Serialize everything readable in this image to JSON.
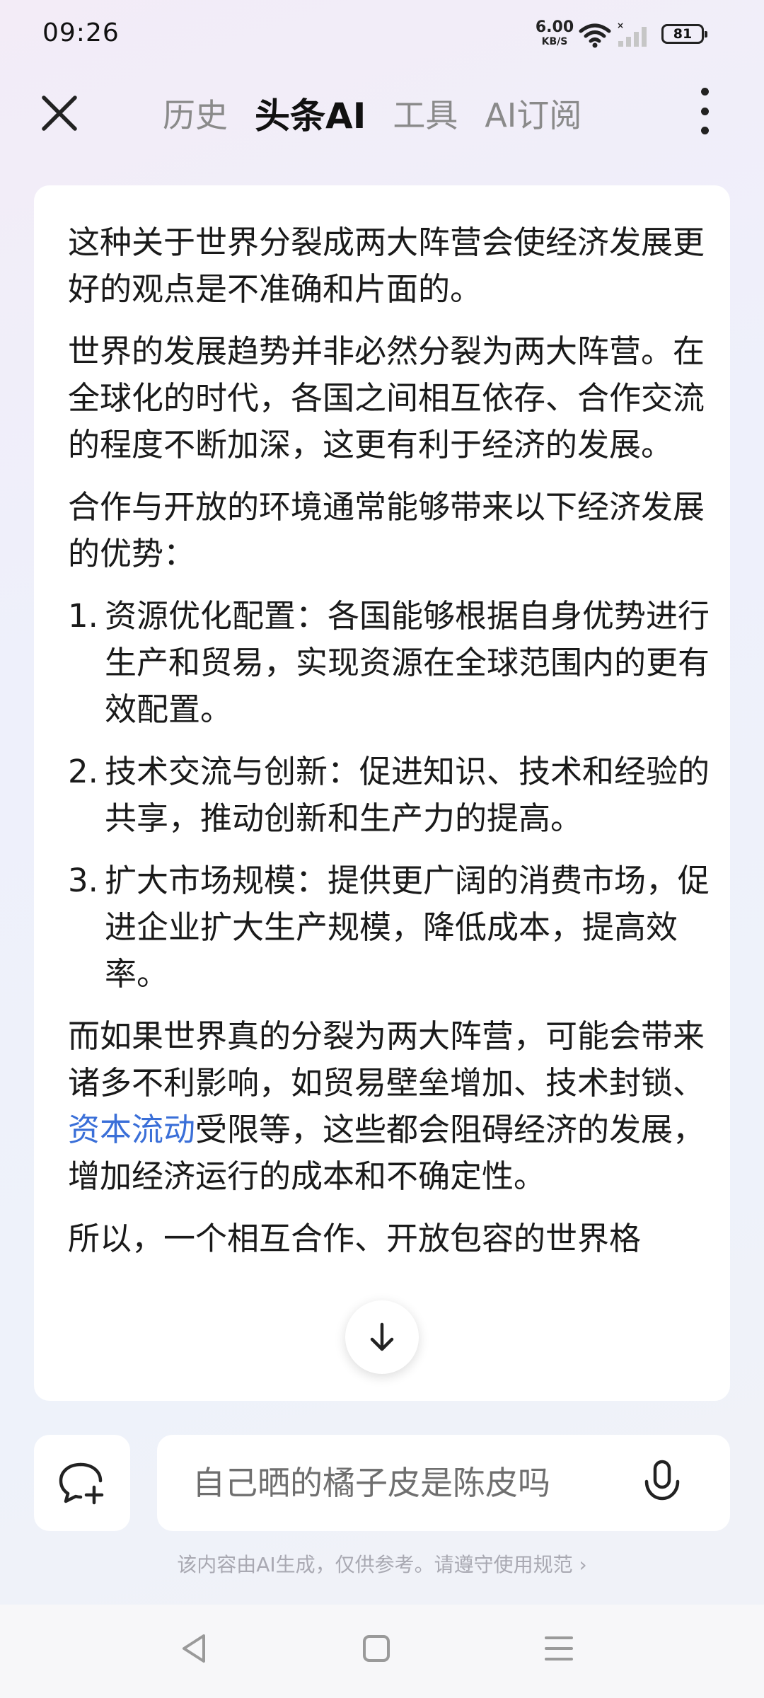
{
  "status_bar": {
    "time": "09:26",
    "net_speed_value": "6.00",
    "net_speed_unit": "KB/S",
    "battery": "81"
  },
  "header": {
    "tabs": [
      {
        "label": "历史",
        "active": false
      },
      {
        "label": "头条AI",
        "active": true
      },
      {
        "label": "工具",
        "active": false
      },
      {
        "label": "AI订阅",
        "active": false
      }
    ]
  },
  "content": {
    "p1": "这种关于世界分裂成两大阵营会使经济发展更好的观点是不准确和片面的。",
    "p2": "世界的发展趋势并非必然分裂为两大阵营。在全球化的时代，各国之间相互依存、合作交流的程度不断加深，这更有利于经济的发展。",
    "p3": "合作与开放的环境通常能够带来以下经济发展的优势：",
    "list": [
      {
        "num": "1.",
        "text": "资源优化配置：各国能够根据自身优势进行生产和贸易，实现资源在全球范围内的更有效配置。"
      },
      {
        "num": "2.",
        "text": "技术交流与创新：促进知识、技术和经验的共享，推动创新和生产力的提高。"
      },
      {
        "num": "3.",
        "text": "扩大市场规模：提供更广阔的消费市场，促进企业扩大生产规模，降低成本，提高效率。"
      }
    ],
    "p4_before": "而如果世界真的分裂为两大阵营，可能会带来诸多不利影响，如贸易壁垒增加、技术封锁、",
    "p4_link": "资本流动",
    "p4_after": "受限等，这些都会阻碍经济的发展，增加经济运行的成本和不确定性。",
    "p5": "所以，一个相互合作、开放包容的世界格"
  },
  "input": {
    "placeholder": "自己晒的橘子皮是陈皮吗"
  },
  "disclaimer": "该内容由AI生成，仅供参考。请遵守使用规范 ›",
  "colors": {
    "link": "#3a6fd8",
    "active_tab": "#111111",
    "inactive_tab": "#8a8a8a"
  },
  "icons": [
    "close-icon",
    "more-icon",
    "arrow-down-icon",
    "new-chat-icon",
    "mic-icon",
    "wifi-icon",
    "signal-icon",
    "battery-icon",
    "back-icon",
    "home-icon",
    "recent-icon"
  ]
}
